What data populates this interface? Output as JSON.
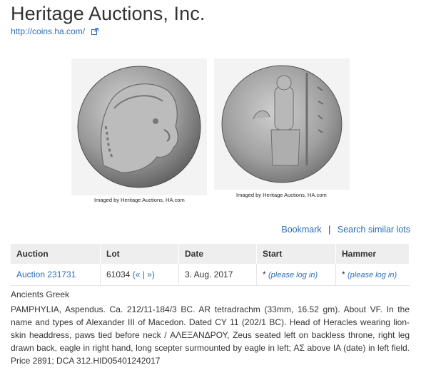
{
  "header": {
    "title": "Heritage Auctions, Inc.",
    "url": "http://coins.ha.com/"
  },
  "images": {
    "credit": "Imaged by Heritage Auctions, HA.com",
    "obverse_subject": "Head of Heracles in lion-skin headdress",
    "reverse_subject": "Zeus seated left on backless throne"
  },
  "tools": {
    "bookmark": "Bookmark",
    "separator": "|",
    "similar": "Search similar lots"
  },
  "table": {
    "headers": [
      "Auction",
      "Lot",
      "Date",
      "Start",
      "Hammer"
    ],
    "row": {
      "auction": "Auction 231731",
      "lot": "61034",
      "lot_nav_open": "(",
      "lot_prev": "«",
      "lot_sep": "|",
      "lot_next": "»",
      "lot_nav_close": ")",
      "date": "3. Aug. 2017",
      "start_star": "*",
      "start_text": "(please log in)",
      "hammer_star": "*",
      "hammer_text": "(please log in)"
    }
  },
  "lot": {
    "category": "Ancients Greek",
    "description": "PAMPHYLIA, Aspendus. Ca. 212/11-184/3 BC. AR tetradrachm (33mm, 16.52 gm). About VF. In the name and types of Alexander III of Macedon. Dated CY 11 (202/1 BC). Head of Heracles wearing lion-skin headdress, paws tied before neck / ΑΛΕΞΑΝΔΡΟΥ, Zeus seated left on backless throne, right leg drawn back, eagle in right hand, long scepter surmounted by eagle in left; ΑΣ above ΙΑ (date) in left field. Price 2891; DCA 312.HID05401242017"
  },
  "colors": {
    "link": "#2a6db5",
    "header_bg": "#eeeeee",
    "text": "#333333"
  }
}
